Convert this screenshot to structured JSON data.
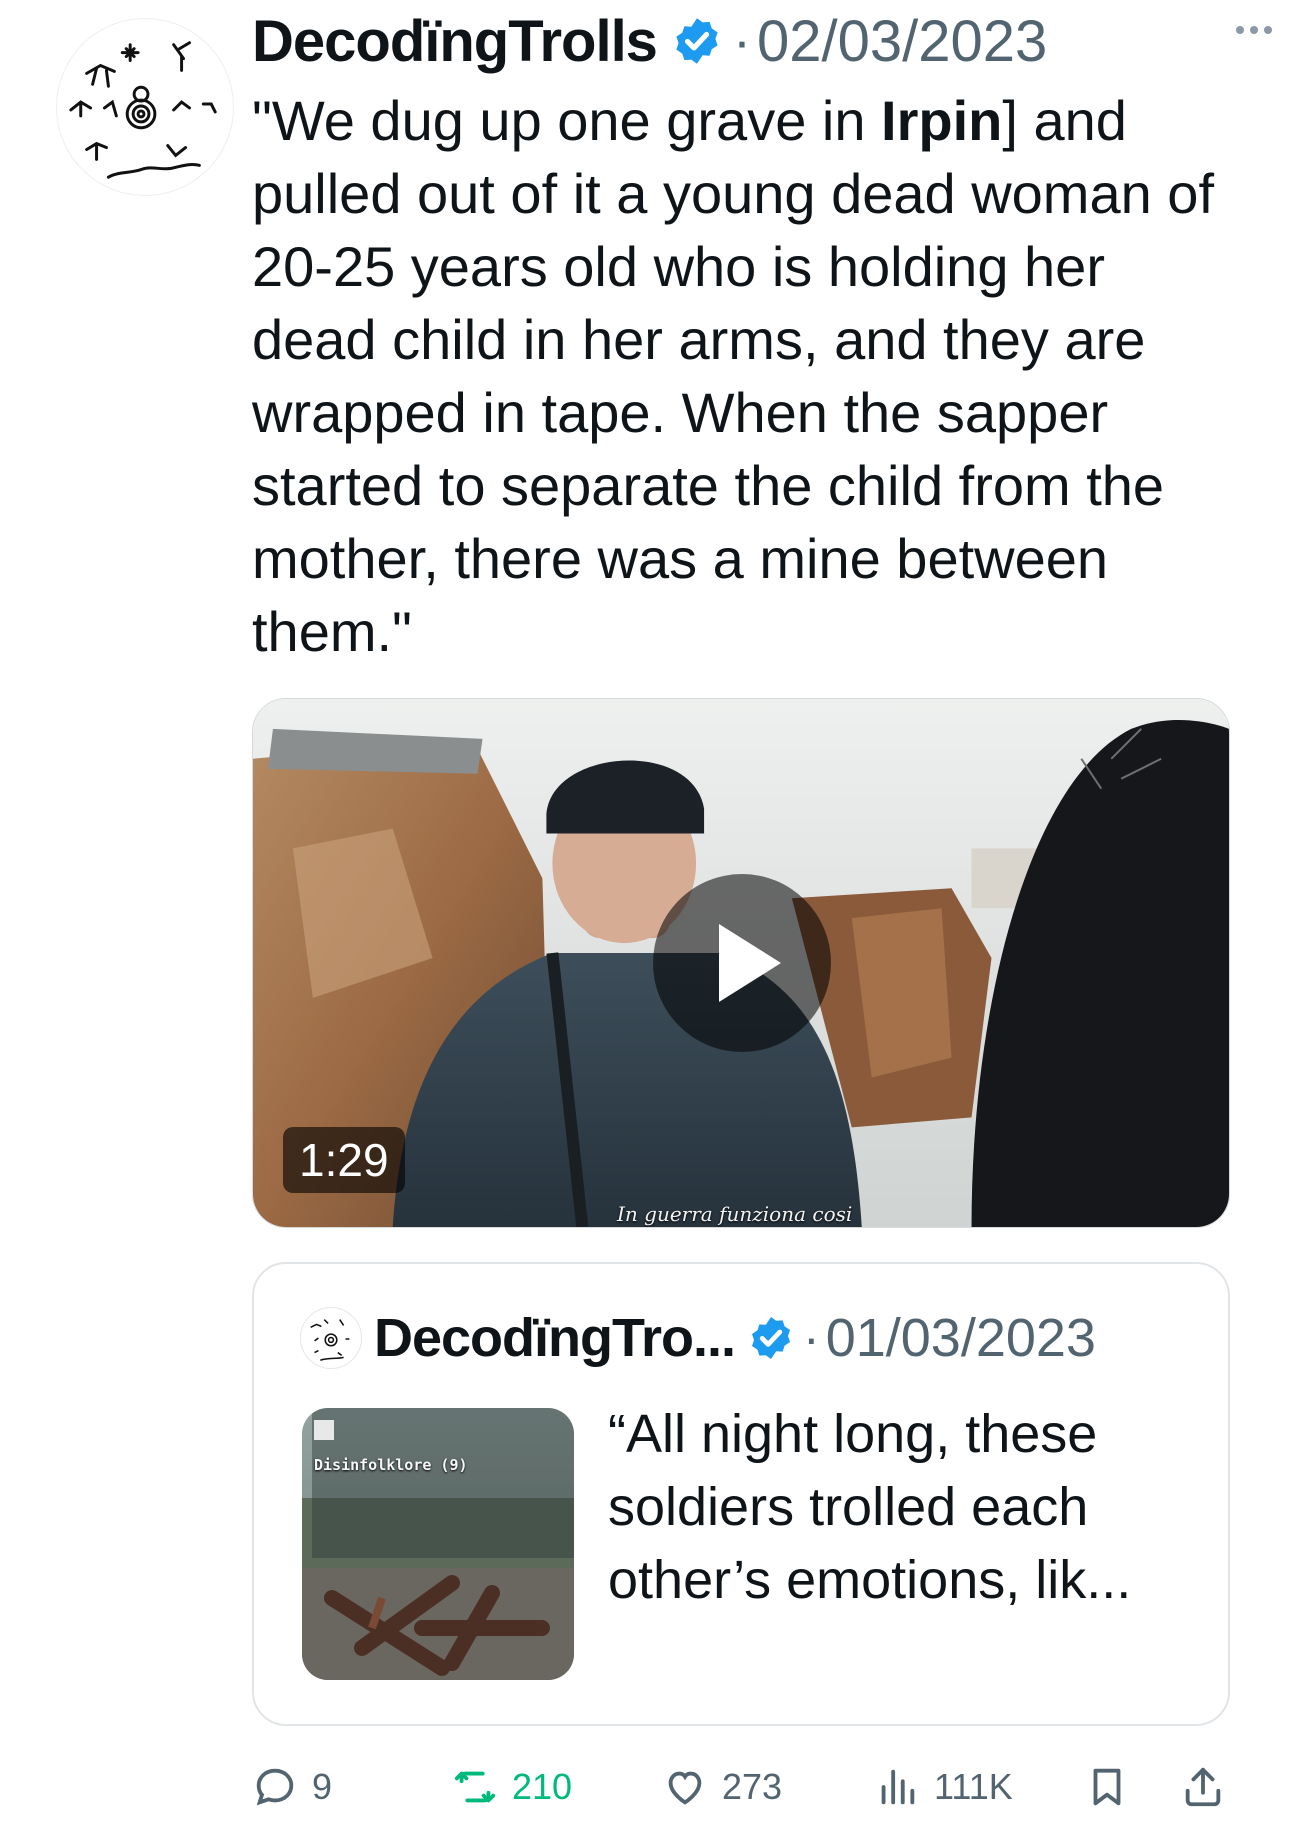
{
  "tweet": {
    "author": "DecodïngTrolls",
    "date": "02/03/2023",
    "text_parts": {
      "before": "\"We dug up one grave in ",
      "bold": "Irpin",
      "after": "] and pulled out of it a young dead woman of 20-25 years old who is holding her dead child in her arms, and they are wrapped in tape. When the sapper started to separate the child from the mother, there was a mine between them.\""
    },
    "video": {
      "duration": "1:29",
      "subtitle": "In guerra funziona cosi"
    }
  },
  "quoted": {
    "author": "DecodïngTro...",
    "date": "01/03/2023",
    "text": "“All night long, these soldiers trolled each other’s emotions, lik...",
    "thumbnail_title": "Disinfolklore (9)"
  },
  "actions": {
    "replies": "9",
    "retweets": "210",
    "likes": "273",
    "views": "111K"
  },
  "colors": {
    "verified": "#1d9bf0",
    "retweet": "#00ba7c",
    "muted": "#536471"
  },
  "separator": "·"
}
